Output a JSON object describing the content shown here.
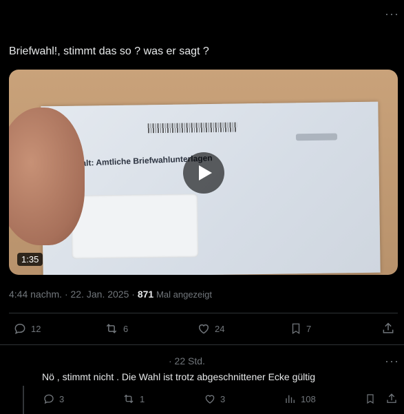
{
  "tweet": {
    "text": "Briefwahl!, stimmt das so ? was er sagt ?",
    "video": {
      "duration": "1:35",
      "envelope_text": "Inhalt: Amtliche Briefwahlunterlagen"
    },
    "time": "4:44 nachm.",
    "date": "22. Jan. 2025",
    "views_count": "871",
    "views_label": "Mal angezeigt",
    "actions": {
      "replies": "12",
      "reposts": "6",
      "likes": "24",
      "bookmarks": "7"
    }
  },
  "reply": {
    "time": "· 22 Std.",
    "text": "Nö , stimmt nicht . Die Wahl ist trotz abgeschnittener Ecke gültig",
    "actions": {
      "replies": "3",
      "reposts": "1",
      "likes": "3",
      "views": "108"
    }
  },
  "icons": [
    "more-icon",
    "play-icon",
    "reply-icon",
    "repost-icon",
    "like-icon",
    "bookmark-icon",
    "share-icon",
    "views-icon"
  ],
  "colors": {
    "background": "#000000",
    "text": "#e7e9ea",
    "muted": "#71767b",
    "divider": "#2f3336"
  }
}
